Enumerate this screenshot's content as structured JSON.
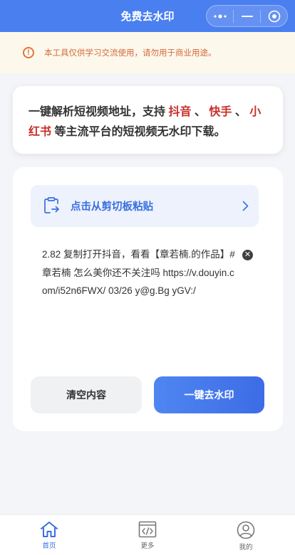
{
  "header": {
    "title": "免费去水印",
    "capsule": {
      "more_icon": "more-dots-icon",
      "minimize_icon": "minimize-icon",
      "close_icon": "target-close-icon"
    }
  },
  "notice": {
    "icon": "alert-circle-icon",
    "text": "本工具仅供学习交流使用，请勿用于商业用途。"
  },
  "intro": {
    "text_before": "一键解析短视频地址，支持 ",
    "platform_1": "抖音",
    "sep_1": " 、 ",
    "platform_2": "快手",
    "sep_2": " 、 ",
    "platform_3": "小红书",
    "text_after": " 等主流平台的短视频无水印下载。",
    "highlight_color": "#c8302c"
  },
  "main": {
    "paste_label": "点击从剪切板粘贴",
    "paste_icon": "clipboard-paste-icon",
    "content": "2.82 复制打开抖音，看看【章若楠.的作品】# 章若楠 怎么美你还不关注吗 https://v.douyin.com/i52n6FWX/ 03/26 y@g.Bg yGV:/",
    "clear_label": "清空内容",
    "submit_label": "一键去水印"
  },
  "tabbar": {
    "items": [
      {
        "label": "首页",
        "icon": "home-icon",
        "active": true
      },
      {
        "label": "更多",
        "icon": "code-icon",
        "active": false
      },
      {
        "label": "我的",
        "icon": "user-icon",
        "active": false
      }
    ]
  },
  "colors": {
    "primary": "#4a7ff0",
    "accent_text": "#3b6fe0",
    "warning": "#e0763c"
  }
}
